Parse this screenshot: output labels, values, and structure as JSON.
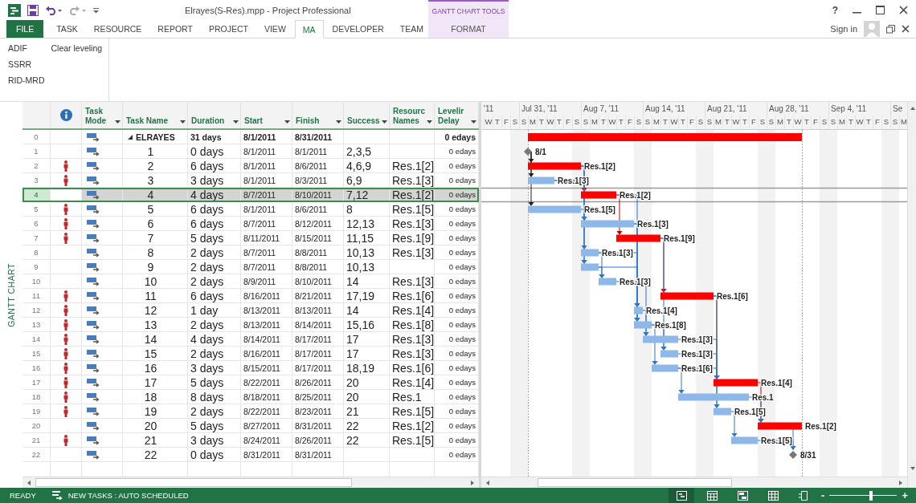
{
  "app": {
    "title": "Elrayes(S-Res).mpp - Project Professional",
    "context_group": "GANTT CHART TOOLS",
    "help": "?"
  },
  "ribbon_tabs": [
    {
      "label": "FILE",
      "kind": "file",
      "selected": false
    },
    {
      "label": "TASK",
      "kind": "tab",
      "selected": false
    },
    {
      "label": "RESOURCE",
      "kind": "tab",
      "selected": false
    },
    {
      "label": "REPORT",
      "kind": "tab",
      "selected": false
    },
    {
      "label": "PROJECT",
      "kind": "tab",
      "selected": false
    },
    {
      "label": "VIEW",
      "kind": "tab",
      "selected": false
    },
    {
      "label": "MA",
      "kind": "tab",
      "selected": true
    },
    {
      "label": "DEVELOPER",
      "kind": "tab",
      "selected": false
    },
    {
      "label": "TEAM",
      "kind": "tab",
      "selected": false
    },
    {
      "label": "FORMAT",
      "kind": "contextual",
      "selected": false
    }
  ],
  "account": {
    "label": "Sign in"
  },
  "ribbon_groups": [
    [
      "ADIF",
      "SSRR",
      "RID-MRD"
    ],
    [
      "Clear leveling"
    ]
  ],
  "view_label": "GANTT CHART",
  "table": {
    "columns": [
      "Task Mode",
      "Task Name",
      "Duration",
      "Start",
      "Finish",
      "Success",
      "Resourc Names",
      "Levelir Delay"
    ],
    "rows": [
      {
        "id": "0",
        "name": "ELRAYES",
        "duration": "31 days",
        "start": "8/1/2011",
        "finish": "8/31/2011",
        "leveling_delay": "0 edays",
        "kind": "summary",
        "expanded": true,
        "critical": true,
        "overallocated": false,
        "selected": false
      },
      {
        "id": "1",
        "name": "1",
        "duration": "0 days",
        "start": "8/1/2011",
        "finish": "8/1/2011",
        "successors": "2,3,5",
        "leveling_delay": "0 edays",
        "kind": "milestone",
        "critical": false,
        "overallocated": false,
        "selected": false,
        "bar_label": "8/1"
      },
      {
        "id": "2",
        "name": "2",
        "duration": "6 days",
        "start": "8/1/2011",
        "finish": "8/6/2011",
        "successors": "4,6,9",
        "resources": "Res.1[2]",
        "leveling_delay": "0 edays",
        "kind": "task",
        "critical": true,
        "overallocated": true,
        "selected": false,
        "bar_label": "Res.1[2]"
      },
      {
        "id": "3",
        "name": "3",
        "duration": "3 days",
        "start": "8/1/2011",
        "finish": "8/3/2011",
        "successors": "6,9",
        "resources": "Res.1[3]",
        "leveling_delay": "0 edays",
        "kind": "task",
        "critical": false,
        "overallocated": true,
        "selected": false,
        "bar_label": "Res.1[3]"
      },
      {
        "id": "4",
        "name": "4",
        "duration": "4 days",
        "start": "8/7/2011",
        "finish": "8/10/2011",
        "successors": "7,12",
        "resources": "Res.1[2]",
        "leveling_delay": "0 edays",
        "kind": "task",
        "critical": true,
        "overallocated": false,
        "selected": true,
        "bar_label": "Res.1[2]"
      },
      {
        "id": "5",
        "name": "5",
        "duration": "6 days",
        "start": "8/1/2011",
        "finish": "8/6/2011",
        "successors": "8",
        "resources": "Res.1[5]",
        "leveling_delay": "0 edays",
        "kind": "task",
        "critical": false,
        "overallocated": true,
        "selected": false,
        "bar_label": "Res.1[5]"
      },
      {
        "id": "6",
        "name": "6",
        "duration": "6 days",
        "start": "8/7/2011",
        "finish": "8/12/2011",
        "successors": "12,13",
        "resources": "Res.1[3]",
        "leveling_delay": "0 edays",
        "kind": "task",
        "critical": false,
        "overallocated": true,
        "selected": false,
        "bar_label": "Res.1[3]"
      },
      {
        "id": "7",
        "name": "7",
        "duration": "5 days",
        "start": "8/11/2011",
        "finish": "8/15/2011",
        "successors": "11,15",
        "resources": "Res.1[9]",
        "leveling_delay": "0 edays",
        "kind": "task",
        "critical": true,
        "overallocated": true,
        "selected": false,
        "bar_label": "Res.1[9]"
      },
      {
        "id": "8",
        "name": "8",
        "duration": "2 days",
        "start": "8/7/2011",
        "finish": "8/8/2011",
        "successors": "10,13",
        "resources": "Res.1[3]",
        "leveling_delay": "0 edays",
        "kind": "task",
        "critical": false,
        "overallocated": false,
        "selected": false,
        "bar_label": "Res.1[3]"
      },
      {
        "id": "9",
        "name": "9",
        "duration": "2 days",
        "start": "8/7/2011",
        "finish": "8/8/2011",
        "successors": "10,13",
        "leveling_delay": "0 edays",
        "kind": "task",
        "critical": false,
        "overallocated": false,
        "selected": false
      },
      {
        "id": "10",
        "name": "10",
        "duration": "2 days",
        "start": "8/9/2011",
        "finish": "8/10/2011",
        "successors": "14",
        "resources": "Res.1[3]",
        "leveling_delay": "0 edays",
        "kind": "task",
        "critical": false,
        "overallocated": false,
        "selected": false,
        "bar_label": "Res.1[3]"
      },
      {
        "id": "11",
        "name": "11",
        "duration": "6 days",
        "start": "8/16/2011",
        "finish": "8/21/2011",
        "successors": "17,19",
        "resources": "Res.1[6]",
        "leveling_delay": "0 edays",
        "kind": "task",
        "critical": true,
        "overallocated": true,
        "selected": false,
        "bar_label": "Res.1[6]"
      },
      {
        "id": "12",
        "name": "12",
        "duration": "1 day",
        "start": "8/13/2011",
        "finish": "8/13/2011",
        "successors": "14",
        "resources": "Res.1[4]",
        "leveling_delay": "0 edays",
        "kind": "task",
        "critical": false,
        "overallocated": true,
        "selected": false,
        "bar_label": "Res.1[4]"
      },
      {
        "id": "13",
        "name": "13",
        "duration": "2 days",
        "start": "8/13/2011",
        "finish": "8/14/2011",
        "successors": "15,16",
        "resources": "Res.1[8]",
        "leveling_delay": "0 edays",
        "kind": "task",
        "critical": false,
        "overallocated": true,
        "selected": false,
        "bar_label": "Res.1[8]"
      },
      {
        "id": "14",
        "name": "14",
        "duration": "4 days",
        "start": "8/14/2011",
        "finish": "8/17/2011",
        "successors": "17",
        "resources": "Res.1[3]",
        "leveling_delay": "0 edays",
        "kind": "task",
        "critical": false,
        "overallocated": true,
        "selected": false,
        "bar_label": "Res.1[3]"
      },
      {
        "id": "15",
        "name": "15",
        "duration": "2 days",
        "start": "8/16/2011",
        "finish": "8/17/2011",
        "successors": "17",
        "resources": "Res.1[3]",
        "leveling_delay": "0 edays",
        "kind": "task",
        "critical": false,
        "overallocated": true,
        "selected": false,
        "bar_label": "Res.1[3]"
      },
      {
        "id": "16",
        "name": "16",
        "duration": "3 days",
        "start": "8/15/2011",
        "finish": "8/17/2011",
        "successors": "18,19",
        "resources": "Res.1[6]",
        "leveling_delay": "0 edays",
        "kind": "task",
        "critical": false,
        "overallocated": true,
        "selected": false,
        "bar_label": "Res.1[6]"
      },
      {
        "id": "17",
        "name": "17",
        "duration": "5 days",
        "start": "8/22/2011",
        "finish": "8/26/2011",
        "successors": "20",
        "resources": "Res.1[4]",
        "leveling_delay": "0 edays",
        "kind": "task",
        "critical": true,
        "overallocated": true,
        "selected": false,
        "bar_label": "Res.1[4]"
      },
      {
        "id": "18",
        "name": "18",
        "duration": "8 days",
        "start": "8/18/2011",
        "finish": "8/25/2011",
        "successors": "20",
        "resources": "Res.1",
        "leveling_delay": "0 edays",
        "kind": "task",
        "critical": false,
        "overallocated": true,
        "selected": false,
        "bar_label": "Res.1"
      },
      {
        "id": "19",
        "name": "19",
        "duration": "2 days",
        "start": "8/22/2011",
        "finish": "8/23/2011",
        "successors": "21",
        "resources": "Res.1[5]",
        "leveling_delay": "0 edays",
        "kind": "task",
        "critical": false,
        "overallocated": true,
        "selected": false,
        "bar_label": "Res.1[5]"
      },
      {
        "id": "20",
        "name": "20",
        "duration": "5 days",
        "start": "8/27/2011",
        "finish": "8/31/2011",
        "successors": "22",
        "resources": "Res.1[2]",
        "leveling_delay": "0 edays",
        "kind": "task",
        "critical": true,
        "overallocated": false,
        "selected": false,
        "bar_label": "Res.1[2]"
      },
      {
        "id": "21",
        "name": "21",
        "duration": "3 days",
        "start": "8/24/2011",
        "finish": "8/26/2011",
        "successors": "22",
        "resources": "Res.1[5]",
        "leveling_delay": "0 edays",
        "kind": "task",
        "critical": false,
        "overallocated": true,
        "selected": false,
        "bar_label": "Res.1[5]"
      },
      {
        "id": "22",
        "name": "22",
        "duration": "0 days",
        "start": "8/31/2011",
        "finish": "8/31/2011",
        "leveling_delay": "0 edays",
        "kind": "milestone",
        "critical": false,
        "overallocated": false,
        "selected": false,
        "bar_label": "8/31"
      }
    ]
  },
  "timescale": {
    "weeks": [
      "'11",
      "Jul 31, '11",
      "Aug 7, '11",
      "Aug 14, '11",
      "Aug 21, '11",
      "Aug 28, '11",
      "Sep 4, '11",
      "Se"
    ],
    "days": [
      "W",
      "T",
      "F",
      "S",
      "S",
      "M",
      "T",
      "W",
      "T",
      "F",
      "S",
      "S",
      "M",
      "T",
      "W",
      "T",
      "F",
      "S",
      "S",
      "M",
      "T",
      "W",
      "T",
      "F",
      "S",
      "S",
      "M",
      "T",
      "W",
      "T",
      "F",
      "S",
      "S",
      "M",
      "T",
      "W",
      "T",
      "F",
      "S",
      "S",
      "M",
      "T",
      "W",
      "T",
      "F",
      "S",
      "S",
      "M"
    ]
  },
  "status_bar": {
    "mode": "READY",
    "new_tasks": "NEW TASKS : AUTO SCHEDULED",
    "view_buttons": [
      {
        "selected": true
      },
      {
        "selected": false
      },
      {
        "selected": false
      },
      {
        "selected": false
      },
      {
        "selected": false
      }
    ],
    "zoom": {
      "minus": "-",
      "plus": "+",
      "level": 0.62
    }
  }
}
